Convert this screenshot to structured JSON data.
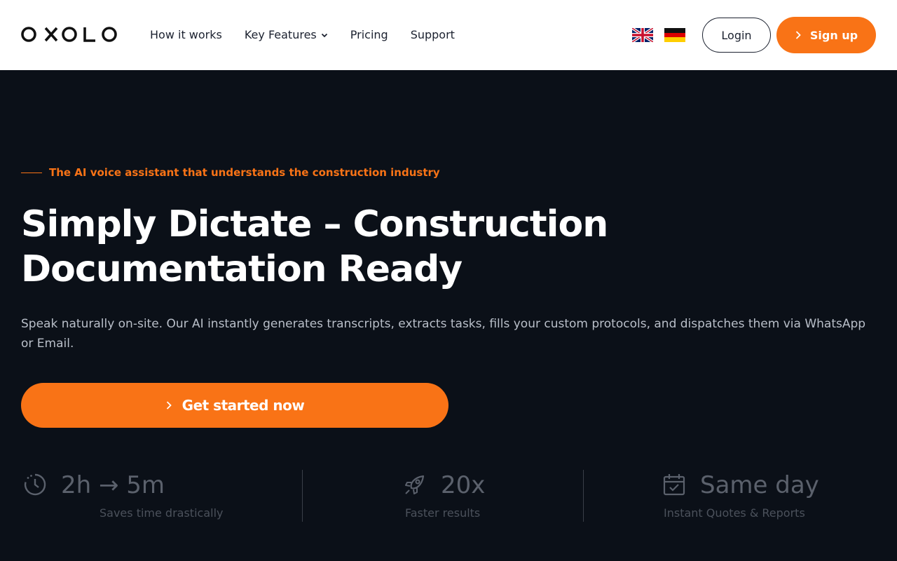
{
  "brand": {
    "logo_text": "OXOLO"
  },
  "nav": {
    "items": [
      {
        "label": "How it works"
      },
      {
        "label": "Key Features",
        "has_dropdown": true
      },
      {
        "label": "Pricing"
      },
      {
        "label": "Support"
      }
    ],
    "languages": [
      {
        "icon": "flag-uk-icon"
      },
      {
        "icon": "flag-de-icon"
      }
    ],
    "login_label": "Login",
    "signup_label": "Sign up"
  },
  "hero": {
    "eyebrow": "The AI voice assistant that understands the construction industry",
    "headline": "Simply Dictate – Construction Documentation Ready",
    "subtext": "Speak naturally on-site. Our AI instantly generates transcripts, extracts tasks, fills your custom protocols, and dispatches them via WhatsApp or Email.",
    "cta_label": "Get started now"
  },
  "stats": [
    {
      "icon": "clock-icon",
      "value": "2h → 5m",
      "label": "Saves time drastically"
    },
    {
      "icon": "rocket-icon",
      "value": "20x",
      "label": "Faster results"
    },
    {
      "icon": "calendar-check-icon",
      "value": "Same day",
      "label": "Instant Quotes & Reports"
    }
  ],
  "colors": {
    "accent": "#f97316",
    "hero_bg": "#0b1018",
    "nav_bg": "#ffffff"
  }
}
